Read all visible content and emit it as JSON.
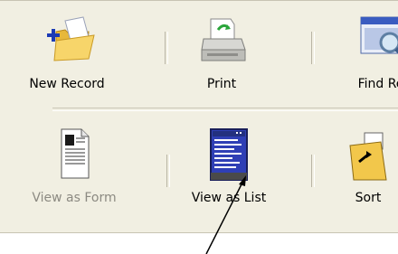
{
  "toolbar": {
    "row1": [
      {
        "label": "New Record",
        "icon": "new-record-icon"
      },
      {
        "label": "Print",
        "icon": "printer-icon"
      },
      {
        "label": "Find Re",
        "icon": "find-records-icon"
      }
    ],
    "row2": [
      {
        "label": "View as Form",
        "icon": "form-view-icon",
        "disabled": true
      },
      {
        "label": "View as List",
        "icon": "list-view-icon"
      },
      {
        "label": "Sort",
        "icon": "sort-icon"
      }
    ]
  },
  "colors": {
    "panel_bg": "#f1efe2",
    "disabled_text": "#8c8a82",
    "list_icon_blue": "#2f3fb5",
    "folder_yellow": "#f2c74b"
  }
}
